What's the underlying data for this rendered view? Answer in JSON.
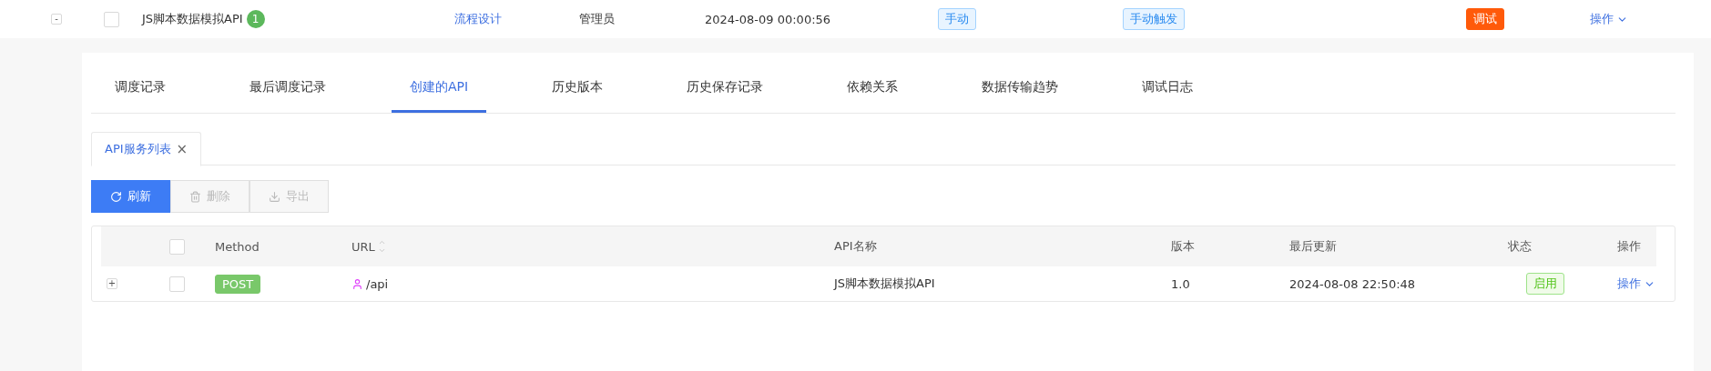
{
  "top_row": {
    "toggle": "-",
    "checked": false,
    "name": "JS脚本数据模拟API",
    "count": "1",
    "category": "流程设计",
    "owner": "管理员",
    "time": "2024-08-09 00:00:56",
    "mode": "手动",
    "trigger": "手动触发",
    "status": "调试",
    "action": "操作"
  },
  "tabs": [
    {
      "label": "调度记录",
      "selected": false
    },
    {
      "label": "最后调度记录",
      "selected": false
    },
    {
      "label": "创建的API",
      "selected": true
    },
    {
      "label": "历史版本",
      "selected": false
    },
    {
      "label": "历史保存记录",
      "selected": false
    },
    {
      "label": "依赖关系",
      "selected": false
    },
    {
      "label": "数据传输趋势",
      "selected": false
    },
    {
      "label": "调试日志",
      "selected": false
    }
  ],
  "sub_tab": {
    "label": "API服务列表",
    "close": "×"
  },
  "toolbar": [
    {
      "kind": "refresh",
      "label": "刷新",
      "disabled": false
    },
    {
      "kind": "delete",
      "label": "删除",
      "disabled": true
    },
    {
      "kind": "export",
      "label": "导出",
      "disabled": true
    }
  ],
  "table": {
    "header_checked": false,
    "columns": [
      "Method",
      "URL",
      "API名称",
      "版本",
      "最后更新",
      "状态",
      "操作"
    ],
    "rows": [
      {
        "toggle": "+",
        "checked": false,
        "method": "POST",
        "url": "/api",
        "name": "JS脚本数据模拟API",
        "version": "1.0",
        "updated": "2024-08-08 22:50:48",
        "status": "启用",
        "action": "操作"
      }
    ]
  }
}
